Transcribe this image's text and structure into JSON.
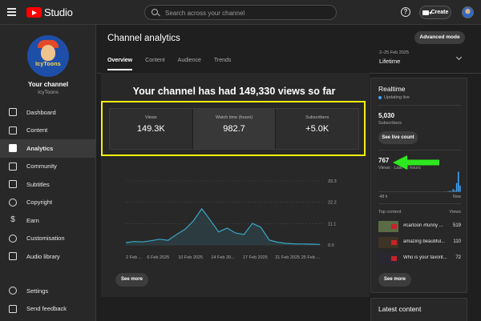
{
  "header": {
    "app_name": "Studio",
    "search_placeholder": "Search across your channel",
    "help_label": "?",
    "create_label": "Create"
  },
  "sidebar": {
    "brand_text": "IcyToons",
    "your_channel": "Your channel",
    "channel_name": "IcyToons",
    "items": [
      {
        "label": "Dashboard",
        "icon": "dashboard-icon"
      },
      {
        "label": "Content",
        "icon": "content-icon"
      },
      {
        "label": "Analytics",
        "icon": "analytics-icon",
        "active": true
      },
      {
        "label": "Community",
        "icon": "community-icon"
      },
      {
        "label": "Subtitles",
        "icon": "subtitles-icon"
      },
      {
        "label": "Copyright",
        "icon": "copyright-icon"
      },
      {
        "label": "Earn",
        "icon": "earn-icon"
      },
      {
        "label": "Customisation",
        "icon": "customisation-icon"
      },
      {
        "label": "Audio library",
        "icon": "audio-library-icon"
      }
    ],
    "bottom_items": [
      {
        "label": "Settings",
        "icon": "settings-icon"
      },
      {
        "label": "Send feedback",
        "icon": "feedback-icon"
      }
    ]
  },
  "main": {
    "title": "Channel analytics",
    "advanced_mode": "Advanced mode",
    "tabs": [
      "Overview",
      "Content",
      "Audience",
      "Trends"
    ],
    "active_tab": 0,
    "date_range": "2–25 Feb 2025",
    "date_label": "Lifetime",
    "headline": "Your channel has had 149,330 views so far",
    "stats": [
      {
        "label": "Views",
        "value": "149.3K"
      },
      {
        "label": "Watch time (hours)",
        "value": "982.7"
      },
      {
        "label": "Subscribers",
        "value": "+5.0K"
      }
    ],
    "see_more": "See more"
  },
  "chart_data": {
    "type": "area",
    "x": [
      "2 Feb",
      "3 Feb",
      "4 Feb",
      "5 Feb",
      "6 Feb",
      "7 Feb",
      "8 Feb",
      "9 Feb",
      "10 Feb",
      "11 Feb",
      "12 Feb",
      "13 Feb",
      "14 Feb",
      "15 Feb",
      "16 Feb",
      "17 Feb",
      "18 Feb",
      "19 Feb",
      "20 Feb",
      "21 Feb",
      "22 Feb",
      "23 Feb",
      "24 Feb",
      "25 Feb"
    ],
    "x_tick_labels": [
      "2 Feb ...",
      "6 Feb 2025",
      "10 Feb 2025",
      "14 Feb 20...",
      "17 Feb 2025",
      "21 Feb 2025",
      "25 Feb ..."
    ],
    "series": [
      {
        "values": [
          1.2,
          1.8,
          1.6,
          2.2,
          3.0,
          2.4,
          5.4,
          8.1,
          12.5,
          18.8,
          13.0,
          6.8,
          8.8,
          6.2,
          5.4,
          11.2,
          9.2,
          2.6,
          1.4,
          0.8,
          0.6,
          0.5,
          0.4,
          0.3
        ]
      }
    ],
    "y_ticks": [
      "33.3",
      "22.2",
      "11.1",
      "0.0"
    ],
    "ylim": [
      0,
      33.3
    ],
    "grid": true
  },
  "realtime": {
    "title": "Realtime",
    "updating": "Updating live",
    "subscribers": "5,030",
    "subscribers_label": "Subscribers",
    "see_live_count": "See live count",
    "views": "767",
    "views_label": "Views · Last 48 hours",
    "bars": [
      0,
      0,
      0,
      0,
      0,
      0,
      0,
      0,
      0,
      0,
      0,
      0,
      0,
      0,
      0,
      0,
      0,
      0,
      0,
      0,
      0,
      0,
      0,
      0,
      0,
      0,
      0,
      0,
      0,
      0,
      0,
      0,
      0,
      0,
      0,
      0,
      0,
      0,
      1,
      0,
      2,
      4,
      3,
      12,
      6,
      40,
      92,
      28
    ],
    "axis_left": "-48 h",
    "axis_right": "Now",
    "top_content_label": "Top content",
    "views_col_label": "Views",
    "top_content": [
      {
        "title": "#cartoon #funny ...",
        "views": "519"
      },
      {
        "title": "amazing beautiful...",
        "views": "110"
      },
      {
        "title": "Who is your favorit...",
        "views": "72"
      }
    ],
    "see_more": "See more"
  },
  "latest": {
    "title": "Latest content"
  },
  "colors": {
    "accent": "#3ea6ff",
    "highlight_box": "#f2f20a",
    "arrow": "#2ee81f",
    "line": "#3aa6c6"
  }
}
